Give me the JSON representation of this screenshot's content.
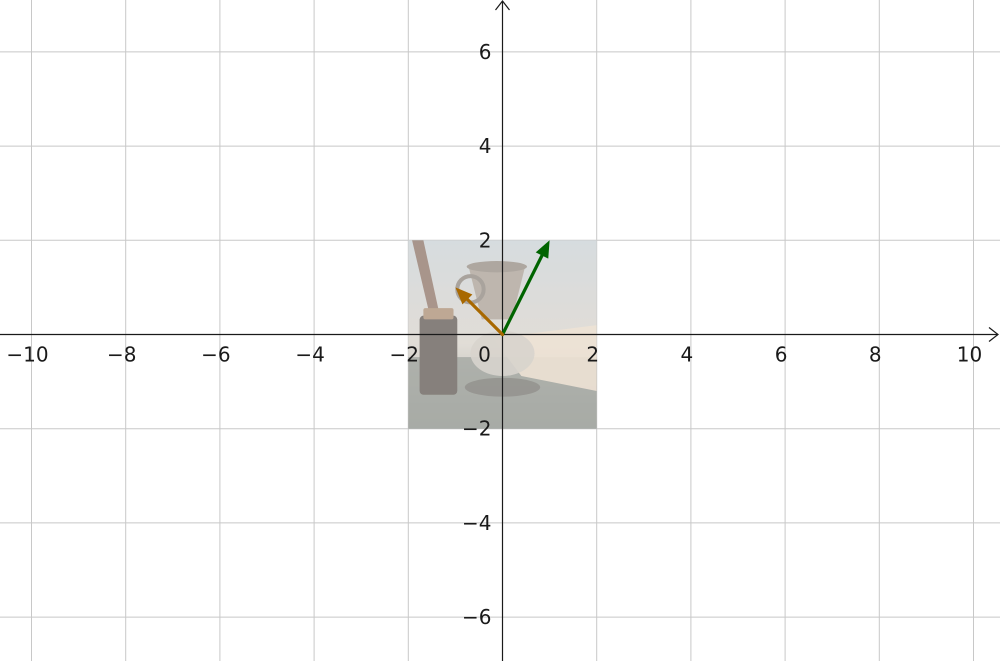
{
  "graph": {
    "x_range": [
      -10.6,
      10.6
    ],
    "y_range": [
      -7,
      7
    ],
    "grid_step": 2,
    "x_ticks": [
      {
        "value": -10,
        "label": "−10"
      },
      {
        "value": -8,
        "label": "−8"
      },
      {
        "value": -6,
        "label": "−6"
      },
      {
        "value": -4,
        "label": "−4"
      },
      {
        "value": -2,
        "label": "−2"
      },
      {
        "value": 0,
        "label": "0"
      },
      {
        "value": 2,
        "label": "2"
      },
      {
        "value": 4,
        "label": "4"
      },
      {
        "value": 6,
        "label": "6"
      },
      {
        "value": 8,
        "label": "8"
      },
      {
        "value": 10,
        "label": "10"
      }
    ],
    "y_ticks": [
      {
        "value": 6,
        "label": "6"
      },
      {
        "value": 4,
        "label": "4"
      },
      {
        "value": 2,
        "label": "2"
      },
      {
        "value": -2,
        "label": "−2"
      },
      {
        "value": -4,
        "label": "−4"
      },
      {
        "value": -6,
        "label": "−6"
      }
    ],
    "image": {
      "x_min": -2,
      "x_max": 2,
      "y_min": -2,
      "y_max": 2,
      "content": "coffee-pour-over-photo"
    },
    "vectors": [
      {
        "name": "green-vector",
        "from": [
          0,
          0
        ],
        "to": [
          1,
          2
        ],
        "color": "#006400"
      },
      {
        "name": "orange-vector",
        "from": [
          0,
          0
        ],
        "to": [
          -1,
          1
        ],
        "color": "#a86800"
      }
    ],
    "colors": {
      "grid": "#c8c8c8",
      "axis": "#1a1a1a",
      "background": "#ffffff"
    }
  }
}
